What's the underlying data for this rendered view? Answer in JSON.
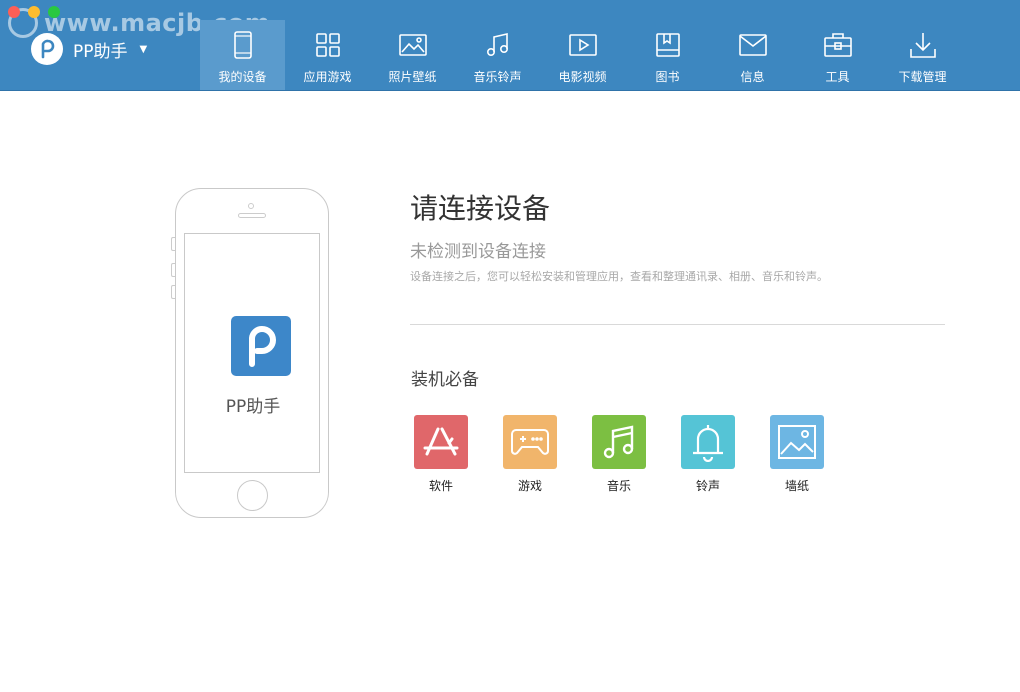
{
  "watermark": {
    "text": "www.macjb.com"
  },
  "brand": {
    "name": "PP助手"
  },
  "nav": [
    {
      "label": "我的设备",
      "icon": "phone-icon"
    },
    {
      "label": "应用游戏",
      "icon": "apps-grid-icon"
    },
    {
      "label": "照片壁纸",
      "icon": "image-icon"
    },
    {
      "label": "音乐铃声",
      "icon": "music-note-icon"
    },
    {
      "label": "电影视频",
      "icon": "video-play-icon"
    },
    {
      "label": "图书",
      "icon": "book-icon"
    },
    {
      "label": "信息",
      "icon": "mail-icon"
    },
    {
      "label": "工具",
      "icon": "toolbox-icon"
    },
    {
      "label": "下载管理",
      "icon": "download-icon"
    }
  ],
  "device": {
    "app_label": "PP助手"
  },
  "main": {
    "title": "请连接设备",
    "subtitle": "未检测到设备连接",
    "description": "设备连接之后，您可以轻松安装和管理应用，查看和整理通讯录、相册、音乐和铃声。",
    "section_title": "装机必备",
    "apps": [
      {
        "label": "软件",
        "icon": "app-store-icon",
        "color": "#e0676a"
      },
      {
        "label": "游戏",
        "icon": "gamepad-icon",
        "color": "#f1b56b"
      },
      {
        "label": "音乐",
        "icon": "music-note-icon",
        "color": "#7cbf42"
      },
      {
        "label": "铃声",
        "icon": "bell-icon",
        "color": "#55c4d6"
      },
      {
        "label": "墙纸",
        "icon": "wallpaper-icon",
        "color": "#6db6e3"
      }
    ]
  },
  "colors": {
    "header": "#3d87c0",
    "nav_active": "#5a9bcd",
    "brand_blue": "#3d87c9"
  }
}
